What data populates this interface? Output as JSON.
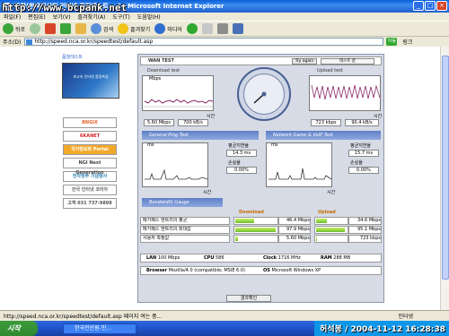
{
  "window": {
    "title": "종합(한국전산원 인터넷 품질테스트 ...) - Microsoft Internet Explorer",
    "watermark": "http://www.bcpank.net"
  },
  "menu": [
    "파일(F)",
    "편집(E)",
    "보기(V)",
    "즐겨찾기(A)",
    "도구(T)",
    "도움말(H)"
  ],
  "toolbar": {
    "back": "뒤로",
    "search": "검색",
    "favorites": "즐겨찾기",
    "media": "미디어"
  },
  "address": {
    "label": "주소(D)",
    "url": "http://speed.nca.or.kr/speedtest/default.asp",
    "go": "이동",
    "links": "링크"
  },
  "leftnav": {
    "header": "품질테스트",
    "promo": "초고속 인터넷 품질측정",
    "banners": [
      {
        "label": "BNGIX",
        "color": "#e5652e"
      },
      {
        "label": "6KANET",
        "color": "#d32626"
      },
      {
        "label": "국가정보화 Portal",
        "color": "#f3a92a"
      },
      {
        "label": "NGI Next Generation",
        "color": "#444444"
      },
      {
        "label": "전자정부 기념행사",
        "color": "#2f7fb0"
      },
      {
        "label": "한국 인터넷 코리아",
        "color": "#666666"
      },
      {
        "label": "고객 031 737-9898",
        "color": "#555555"
      }
    ]
  },
  "test": {
    "tab": "WAN TEST",
    "try_again": "Try again",
    "end_test": "테스트 끝",
    "download_title": "Download test",
    "upload_title": "Upload test",
    "mbps_unit": "Mbps",
    "time_label": "시간",
    "download_mbps": "5.60 Mbps",
    "download_kbs": "700 kB/s",
    "upload_kbps": "723 kbps",
    "upload_kbs": "90.4 kB/s",
    "ping_title": "General Ping Test",
    "game_title": "Network Game & VoIP Test",
    "ms_unit": "ms",
    "avg_latency": "평균지연율",
    "loss_rate": "손실율",
    "ping_latency": "14.3 ms",
    "ping_loss": "0.00%",
    "game_latency": "15.7 ms",
    "game_loss": "0.00%",
    "bandwidth_title": "Bandwidth Gauge",
    "download_label": "Download",
    "upload_label": "Upload"
  },
  "gauge_rows": [
    {
      "label": "메가패스 엔트리의 평균",
      "down": "46.4 Mbps",
      "down_pct": 46.4,
      "up": "34.6 Mbps",
      "up_pct": 34.6
    },
    {
      "label": "메가패스 엔트리의 최대값",
      "down": "97.9 Mbps",
      "down_pct": 97.9,
      "up": "95.1 Mbps",
      "up_pct": 95.1
    },
    {
      "label": "사용자 측정값",
      "down": "5.60 Mbps",
      "down_pct": 5.6,
      "up": "723 kbps",
      "up_pct": 0.7
    }
  ],
  "system": {
    "lan_label": "LAN",
    "lan": "100 Mbps",
    "cpu_label": "CPU",
    "cpu": "586",
    "clock_label": "Clock",
    "clock": "1716 MHz",
    "ram_label": "RAM",
    "ram": "288 MB",
    "browser_label": "Browser",
    "browser": "Mozilla/4.0 (compatible; MSIE 6.0)",
    "os_label": "OS",
    "os": "Microsoft Windows XP"
  },
  "confirm_button": "결과확인",
  "status": {
    "text": "http://speed.nca.or.kr/speedtest/default.asp 페이지 여는 중...",
    "zone": "인터넷"
  },
  "taskbar": {
    "start": "시작",
    "task": "한국전산원-인...",
    "tray": "허석봉 / 2004-11-12 16:28:38"
  }
}
